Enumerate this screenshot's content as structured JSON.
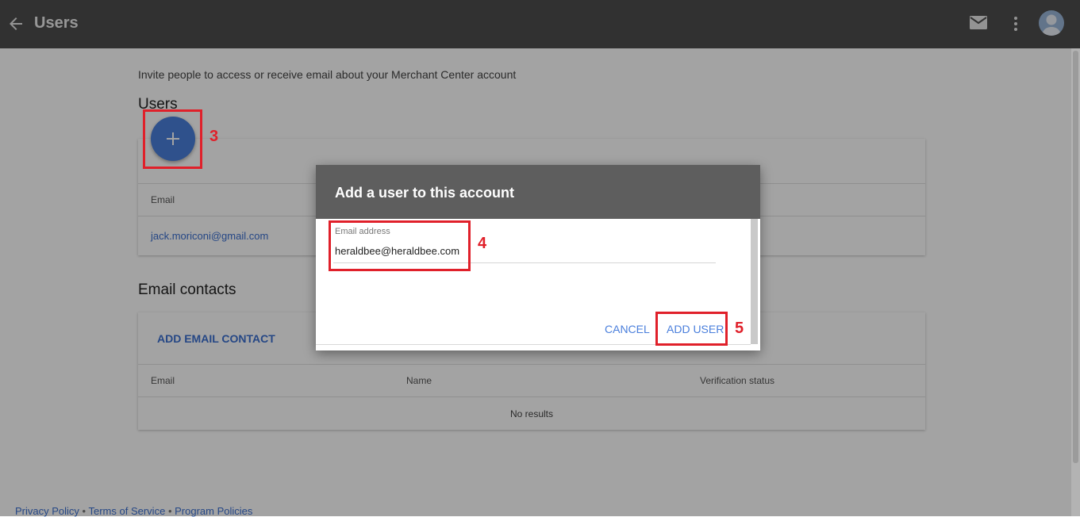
{
  "appbar": {
    "title": "Users",
    "back_icon": "arrow-back-icon",
    "mail_icon": "mail-icon",
    "more_icon": "more-vert-icon",
    "avatar_icon": "account-avatar-icon"
  },
  "page": {
    "intro": "Invite people to access or receive email about your Merchant Center account",
    "users_section": {
      "title": "Users",
      "add_icon": "plus-icon",
      "column_email": "Email",
      "rows": [
        {
          "email": "jack.moriconi@gmail.com"
        }
      ]
    },
    "contacts_section": {
      "title": "Email contacts",
      "add_label": "ADD EMAIL CONTACT",
      "columns": [
        "Email",
        "Name",
        "Verification status"
      ],
      "empty_text": "No results"
    },
    "footer": {
      "links": [
        "Privacy Policy",
        "Terms of Service",
        "Program Policies"
      ],
      "separator": "•"
    }
  },
  "dialog": {
    "title": "Add a user to this account",
    "email_label": "Email address",
    "email_value": "heraldbee@heraldbee.com",
    "cancel_label": "CANCEL",
    "add_label": "ADD USER"
  },
  "annotations": [
    "3",
    "4",
    "5"
  ],
  "colors": {
    "appbar": "#4d4d4d",
    "accent": "#4a7fdc",
    "annotation": "#e0202a"
  }
}
